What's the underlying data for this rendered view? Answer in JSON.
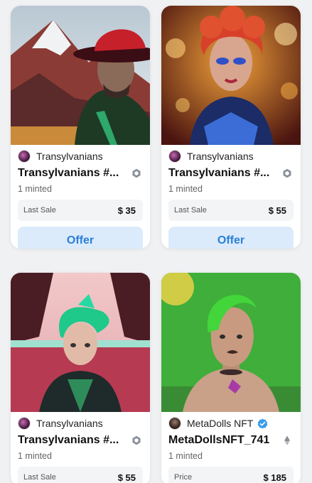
{
  "cards": [
    {
      "collection": "Transylvanians",
      "title": "Transylvanians #...",
      "minted": "1 minted",
      "sale_label": "Last Sale",
      "sale_value": "$ 35",
      "offer_label": "Offer",
      "chain_icon": "polygon-icon",
      "verified": false
    },
    {
      "collection": "Transylvanians",
      "title": "Transylvanians #...",
      "minted": "1 minted",
      "sale_label": "Last Sale",
      "sale_value": "$ 55",
      "offer_label": "Offer",
      "chain_icon": "polygon-icon",
      "verified": false
    },
    {
      "collection": "Transylvanians",
      "title": "Transylvanians #...",
      "minted": "1 minted",
      "sale_label": "Last Sale",
      "sale_value": "$ 55",
      "chain_icon": "polygon-icon",
      "verified": false
    },
    {
      "collection": "MetaDolls NFT",
      "title": "MetaDollsNFT_741",
      "minted": "1 minted",
      "sale_label": "Price",
      "sale_value": "$ 185",
      "chain_icon": "ethereum-icon",
      "verified": true
    }
  ],
  "colors": {
    "offer_bg": "#dcebfb",
    "offer_text": "#2a7fd8",
    "verified": "#3b9be8"
  }
}
